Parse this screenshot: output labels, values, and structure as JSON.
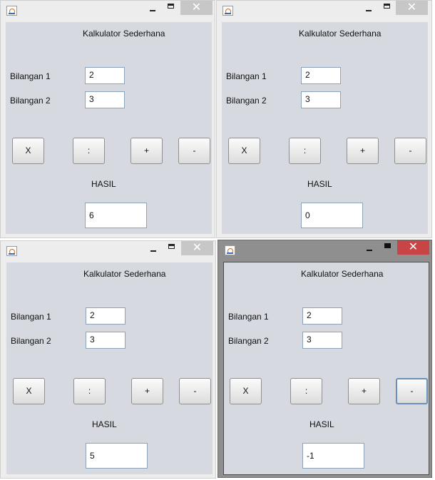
{
  "windows": [
    {
      "title_label": "Kalkulator Sederhana",
      "label_1": "Bilangan 1",
      "value_1": "2",
      "label_2": "Bilangan 2",
      "value_2": "3",
      "buttons": [
        "X",
        ":",
        "+",
        "-"
      ],
      "hasil_label": "HASIL",
      "hasil_value": "6",
      "controls": {
        "minimize": "",
        "maximize": "",
        "close": "✕"
      }
    },
    {
      "title_label": "Kalkulator Sederhana",
      "label_1": "Bilangan 1",
      "value_1": "2",
      "label_2": "Bilangan 2",
      "value_2": "3",
      "buttons": [
        "X",
        ":",
        "+",
        "-"
      ],
      "hasil_label": "HASIL",
      "hasil_value": "0",
      "controls": {
        "minimize": "",
        "maximize": "",
        "close": "✕"
      }
    },
    {
      "title_label": "Kalkulator Sederhana",
      "label_1": "Bilangan 1",
      "value_1": "2",
      "label_2": "Bilangan 2",
      "value_2": "3",
      "buttons": [
        "X",
        ":",
        "+",
        "-"
      ],
      "hasil_label": "HASIL",
      "hasil_value": "5",
      "controls": {
        "minimize": "",
        "maximize": "",
        "close": "✕"
      }
    },
    {
      "title_label": "Kalkulator Sederhana",
      "label_1": "Bilangan 1",
      "value_1": "2",
      "label_2": "Bilangan 2",
      "value_2": "3",
      "buttons": [
        "X",
        ":",
        "+",
        "-"
      ],
      "hasil_label": "HASIL",
      "hasil_value": "-1",
      "controls": {
        "minimize": "",
        "maximize": "",
        "close": "✕"
      }
    }
  ],
  "colors": {
    "client_bg": "#d6d9e0",
    "frame_bg": "#ededed",
    "active_frame_bg": "#8f8f8f",
    "active_close_bg": "#c94444",
    "inactive_close_bg": "#c7c7c7"
  },
  "icons": {
    "app": "java-app-icon",
    "minimize": "minimize-icon",
    "maximize": "maximize-icon",
    "close": "close-icon"
  }
}
